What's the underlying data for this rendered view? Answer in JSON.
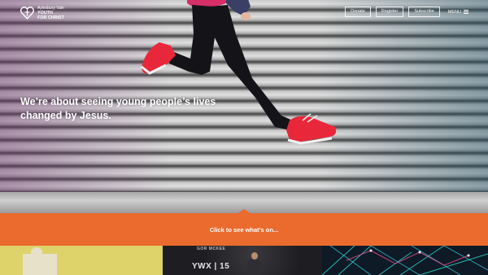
{
  "org": {
    "line1": "Aylesbury Vale",
    "line2": "YOUTH",
    "line3": "FOR CHRIST"
  },
  "nav": {
    "donate": "Donate",
    "register": "Register",
    "subscribe": "Subscribe",
    "menu": "MENU"
  },
  "hero": {
    "headline": "We’re about seeing young people’s lives changed by Jesus."
  },
  "cta": {
    "label": "Click to see what’s on..."
  },
  "tiles": {
    "tile2_name": "GOR MCKEE",
    "tile2_brand": "YWX | 15"
  },
  "colors": {
    "accent": "#eb6a2e",
    "shoe": "#e8283a",
    "white": "#ffffff"
  },
  "icons": [
    "heart-logo-icon",
    "hamburger-menu-icon"
  ]
}
